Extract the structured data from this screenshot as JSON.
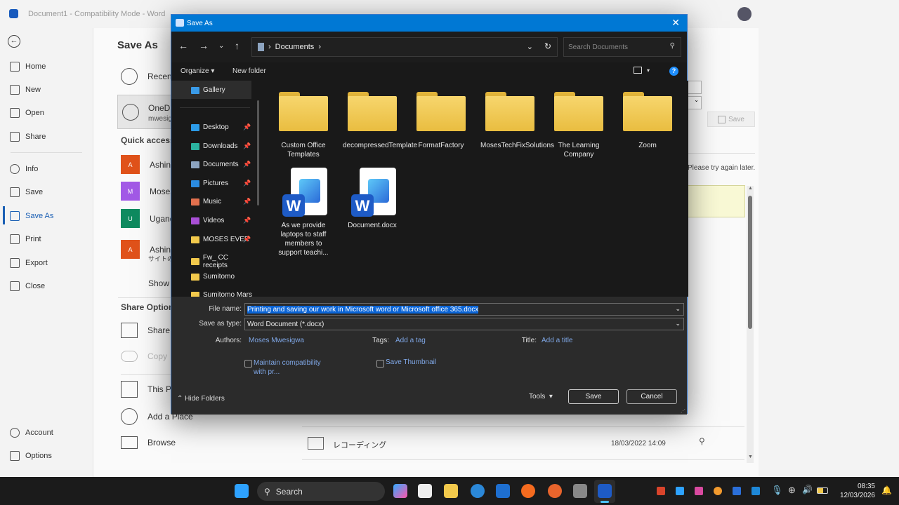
{
  "word": {
    "window_title": "Document1  -  Compatibility Mode  -  Word",
    "nav": {
      "back": "back",
      "items": [
        {
          "label": "Home"
        },
        {
          "label": "New"
        },
        {
          "label": "Open"
        },
        {
          "label": "Share"
        },
        {
          "label": "Info"
        },
        {
          "label": "Save"
        },
        {
          "label": "Save As"
        },
        {
          "label": "Print"
        },
        {
          "label": "Export"
        },
        {
          "label": "Close"
        },
        {
          "label": "Account"
        },
        {
          "label": "Options"
        }
      ]
    },
    "page_title": "Save As",
    "locations": {
      "recent": "Recent",
      "onedrive": "OneD",
      "onedrive_sub": "mwesig"
    },
    "quick_access": {
      "heading": "Quick access",
      "items": [
        {
          "initial": "A",
          "label": "Ashina",
          "color": "#e0521a"
        },
        {
          "initial": "M",
          "label": "Moses",
          "color": "#a259e6"
        },
        {
          "initial": "U",
          "label": "Ugand",
          "color": "#0e8a5f"
        },
        {
          "initial": "A",
          "label": "Ashina",
          "sub": "サイトの",
          "color": "#e0521a"
        }
      ],
      "show_more": "Show"
    },
    "share_options": {
      "heading": "Share Option",
      "share": "Share",
      "copy": "Copy"
    },
    "other": {
      "this_pc": "This P",
      "add_place": "Add a Place",
      "browse": "Browse"
    },
    "save_button": "Save",
    "error_text": "Please try again later.",
    "file_row": {
      "name": "レコーディング",
      "date": "18/03/2022 14:09"
    }
  },
  "dialog": {
    "title": "Save As",
    "address": "Documents",
    "search_placeholder": "Search Documents",
    "organize": "Organize",
    "new_folder": "New folder",
    "nav": [
      {
        "label": "Gallery",
        "icon": "gallery",
        "color": "#3a9be8"
      },
      {
        "label": "Desktop",
        "icon": "desktop",
        "color": "#2c9be8",
        "pinned": true
      },
      {
        "label": "Downloads",
        "icon": "download",
        "color": "#2bb3a0",
        "pinned": true
      },
      {
        "label": "Documents",
        "icon": "documents",
        "color": "#8da4c0",
        "pinned": true
      },
      {
        "label": "Pictures",
        "icon": "pictures",
        "color": "#2b8be0",
        "pinned": true
      },
      {
        "label": "Music",
        "icon": "music",
        "color": "#e2704e",
        "pinned": true
      },
      {
        "label": "Videos",
        "icon": "videos",
        "color": "#a94fd6",
        "pinned": true
      },
      {
        "label": "MOSES EVER",
        "icon": "folder",
        "color": "#f2c94c",
        "pinned": true
      },
      {
        "label": "Fw_ CC receipts",
        "icon": "folder",
        "color": "#f2c94c"
      },
      {
        "label": "Sumitomo",
        "icon": "folder",
        "color": "#f2c94c"
      },
      {
        "label": "Sumitomo Mars",
        "icon": "folder",
        "color": "#f2c94c"
      }
    ],
    "items": [
      {
        "label": "Custom Office Templates",
        "type": "folder"
      },
      {
        "label": "decompressedTemplate",
        "type": "folder"
      },
      {
        "label": "FormatFactory",
        "type": "folder"
      },
      {
        "label": "MosesTechFixSolutions",
        "type": "folder"
      },
      {
        "label": "The Learning Company",
        "type": "folder"
      },
      {
        "label": "Zoom",
        "type": "folder"
      },
      {
        "label": "As we provide laptops to staff members to support teachi...",
        "type": "word"
      },
      {
        "label": "Document.docx",
        "type": "word"
      }
    ],
    "file_name_label": "File name:",
    "file_name": "Printing and saving our work in Microsoft word  or Microsoft office 365.docx",
    "save_type_label": "Save as type:",
    "save_type": "Word Document (*.docx)",
    "authors_label": "Authors:",
    "authors": "Moses Mwesigwa",
    "tags_label": "Tags:",
    "tags": "Add a tag",
    "title_label": "Title:",
    "title_value": "Add a title",
    "maintain": "Maintain compatibility with pr...",
    "thumbnail": "Save Thumbnail",
    "hide_folders": "Hide Folders",
    "tools": "Tools",
    "save": "Save",
    "cancel": "Cancel"
  },
  "taskbar": {
    "search": "Search",
    "time": "08:35",
    "date": "12/03/2026"
  }
}
